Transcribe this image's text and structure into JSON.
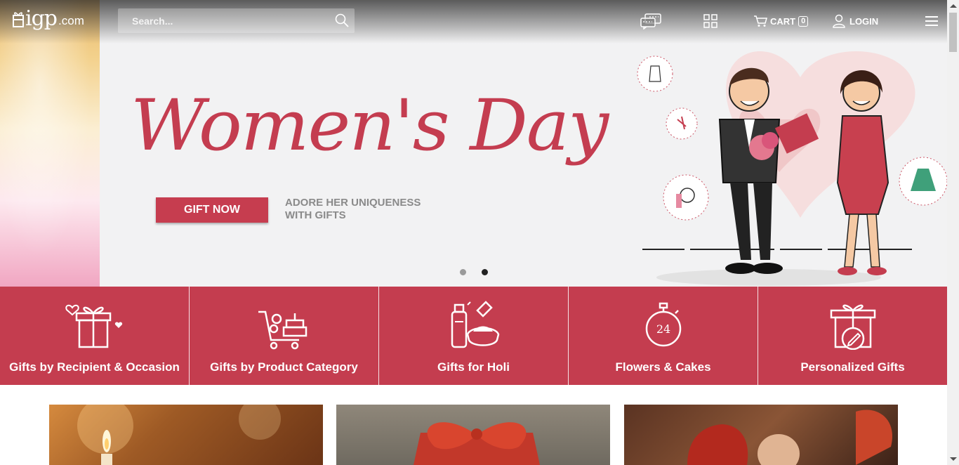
{
  "header": {
    "logo": {
      "mark": "igp",
      "suffix": ".com"
    },
    "search_placeholder": "Search...",
    "cart_label": "CART",
    "cart_count": "0",
    "login_label": "LOGIN"
  },
  "hero": {
    "headline": "Women's Day",
    "cta_label": "GIFT NOW",
    "tagline_line1": "ADORE HER UNIQUENESS",
    "tagline_line2": "WITH GIFTS",
    "slides": 2,
    "active_slide": 2
  },
  "categories": [
    {
      "label": "Gifts by Recipient & Occasion",
      "icon": "gift-heart-icon"
    },
    {
      "label": "Gifts by Product Category",
      "icon": "cart-cake-icon"
    },
    {
      "label": "Gifts for Holi",
      "icon": "holi-colors-icon"
    },
    {
      "label": "Flowers & Cakes",
      "icon": "timer-24-icon",
      "icon_text": "24"
    },
    {
      "label": "Personalized Gifts",
      "icon": "gift-pen-icon"
    }
  ],
  "colors": {
    "accent": "#c43d4f",
    "hero_bg": "#f2f2f3"
  }
}
